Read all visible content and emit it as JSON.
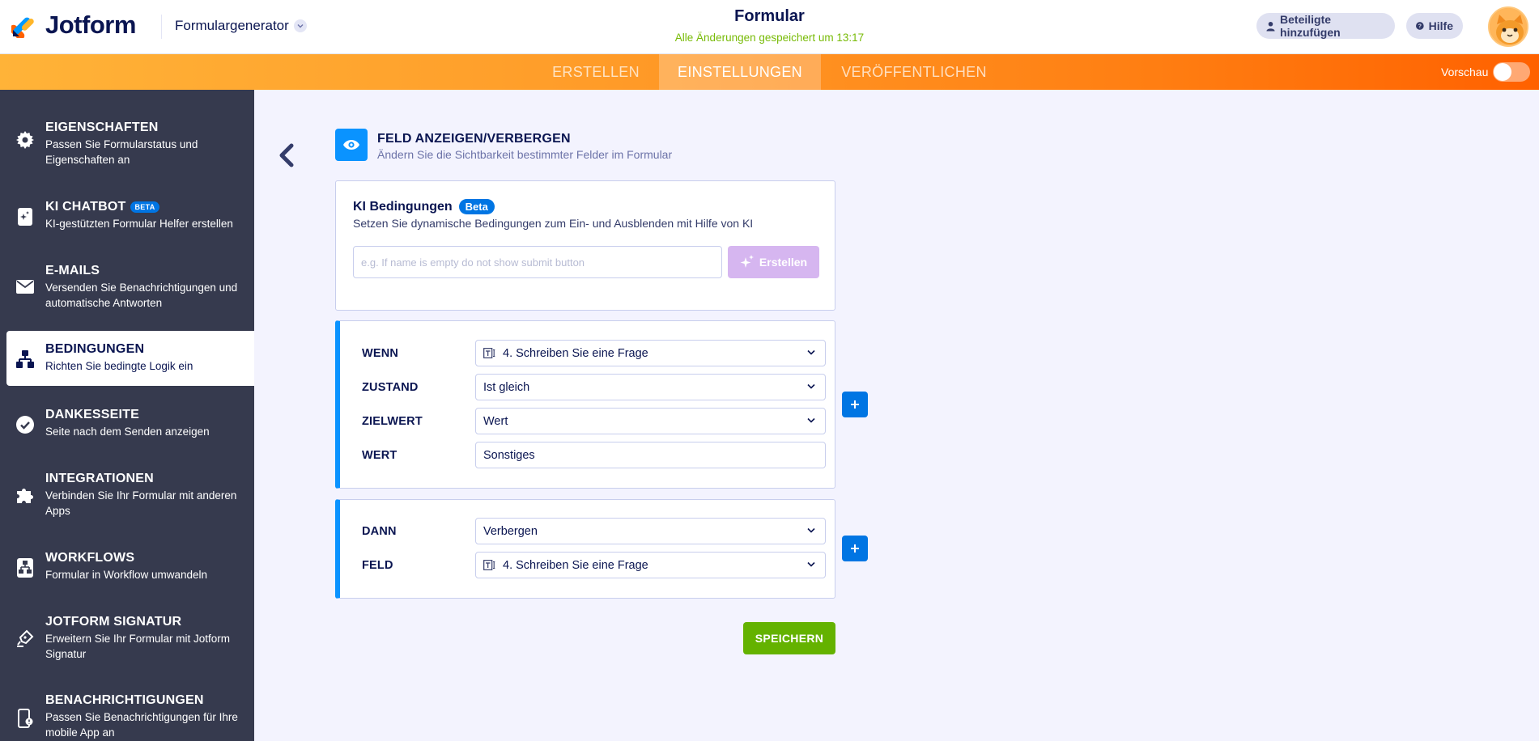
{
  "header": {
    "brand": "Jotform",
    "form_generator": "Formulargenerator",
    "form_title": "Formular",
    "saved_status": "Alle Änderungen gespeichert um 13:17",
    "invite_label": "Beteiligte hinzufügen",
    "help_label": "Hilfe"
  },
  "tabs": {
    "create": "ERSTELLEN",
    "settings": "EINSTELLUNGEN",
    "publish": "VERÖFFENTLICHEN",
    "active": "EINSTELLUNGEN"
  },
  "preview": {
    "label": "Vorschau",
    "enabled": false
  },
  "sidebar": {
    "items": [
      {
        "title": "EIGENSCHAFTEN",
        "desc": "Passen Sie Formularstatus und Eigenschaften an",
        "icon": "gear-icon"
      },
      {
        "title": "KI CHATBOT",
        "badge": "BETA",
        "desc": "KI-gestützten Formular Helfer erstellen",
        "icon": "ai-chatbot-icon"
      },
      {
        "title": "E-MAILS",
        "desc": "Versenden Sie Benachrichtigungen und automatische Antworten",
        "icon": "envelope-icon"
      },
      {
        "title": "BEDINGUNGEN",
        "desc": "Richten Sie bedingte Logik ein",
        "icon": "conditions-icon",
        "active": true
      },
      {
        "title": "DANKESSEITE",
        "desc": "Seite nach dem Senden anzeigen",
        "icon": "check-circle-icon"
      },
      {
        "title": "INTEGRATIONEN",
        "desc": "Verbinden Sie Ihr Formular mit anderen Apps",
        "icon": "puzzle-icon"
      },
      {
        "title": "WORKFLOWS",
        "desc": "Formular in Workflow umwandeln",
        "icon": "workflow-icon"
      },
      {
        "title": "JOTFORM SIGNATUR",
        "desc": "Erweitern Sie Ihr Formular mit Jotform Signatur",
        "icon": "signature-pen-icon"
      },
      {
        "title": "BENACHRICHTIGUNGEN",
        "desc": "Passen Sie Benachrichtigungen für Ihre mobile App an",
        "icon": "mobile-notification-icon"
      }
    ]
  },
  "section": {
    "title": "FELD ANZEIGEN/VERBERGEN",
    "subtitle": "Ändern Sie die Sichtbarkeit bestimmter Felder im Formular",
    "icon": "eye-icon"
  },
  "ai_conditions": {
    "title": "KI Bedingungen",
    "badge": "Beta",
    "subtitle": "Setzen Sie dynamische Bedingungen zum Ein- und Ausblenden mit Hilfe von KI",
    "placeholder": "e.g. If name is empty do not show submit button",
    "button": "Erstellen"
  },
  "condition": {
    "if_label": "WENN",
    "if_value": "4. Schreiben Sie eine Frage",
    "state_label": "ZUSTAND",
    "state_value": "Ist gleich",
    "target_label": "ZIELWERT",
    "target_value": "Wert",
    "value_label": "WERT",
    "value_value": "Sonstiges"
  },
  "action": {
    "then_label": "DANN",
    "then_value": "Verbergen",
    "field_label": "FELD",
    "field_value": "4. Schreiben Sie eine Frage"
  },
  "save_label": "SPEICHERN",
  "colors": {
    "brand_navy": "#0a1551",
    "orange_start": "#ffb338",
    "orange_end": "#ff6100",
    "sidebar_bg": "#363a4e",
    "accent_blue": "#0075e3",
    "save_green": "#64b200",
    "ai_purple": "#d6b6f0"
  }
}
